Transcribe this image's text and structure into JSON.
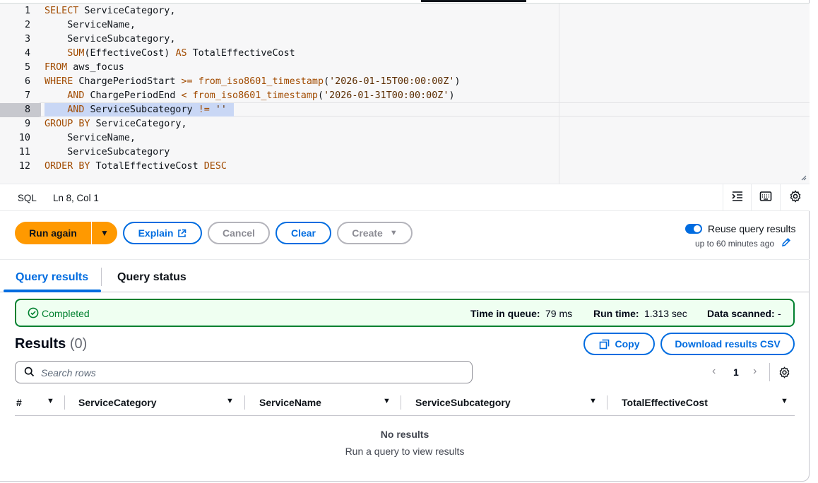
{
  "editor": {
    "lines": [
      {
        "n": "1",
        "tokens": [
          [
            "kw",
            "SELECT"
          ],
          [
            "",
            " ServiceCategory,"
          ]
        ]
      },
      {
        "n": "2",
        "tokens": [
          [
            "",
            "    ServiceName,"
          ]
        ]
      },
      {
        "n": "3",
        "tokens": [
          [
            "",
            "    ServiceSubcategory,"
          ]
        ]
      },
      {
        "n": "4",
        "tokens": [
          [
            "",
            "    "
          ],
          [
            "kw",
            "SUM"
          ],
          [
            "",
            "(EffectiveCost) "
          ],
          [
            "kw",
            "AS"
          ],
          [
            "",
            " TotalEffectiveCost"
          ]
        ]
      },
      {
        "n": "5",
        "tokens": [
          [
            "kw",
            "FROM"
          ],
          [
            "",
            " aws_focus"
          ]
        ]
      },
      {
        "n": "6",
        "tokens": [
          [
            "kw",
            "WHERE"
          ],
          [
            "",
            " ChargePeriodStart "
          ],
          [
            "kw",
            ">="
          ],
          [
            "",
            " "
          ],
          [
            "kw",
            "from_iso8601_timestamp"
          ],
          [
            "",
            "("
          ],
          [
            "str",
            "'2026-01-15T00:00:00Z'"
          ],
          [
            "",
            ")"
          ]
        ]
      },
      {
        "n": "7",
        "tokens": [
          [
            "",
            "    "
          ],
          [
            "kw",
            "AND"
          ],
          [
            "",
            " ChargePeriodEnd "
          ],
          [
            "kw",
            "<"
          ],
          [
            "",
            " "
          ],
          [
            "kw",
            "from_iso8601_timestamp"
          ],
          [
            "",
            "("
          ],
          [
            "str",
            "'2026-01-31T00:00:00Z'"
          ],
          [
            "",
            ")"
          ]
        ]
      },
      {
        "n": "8",
        "tokens": [
          [
            "",
            "    "
          ],
          [
            "kw",
            "AND"
          ],
          [
            "",
            " ServiceSubcategory "
          ],
          [
            "kw",
            "!="
          ],
          [
            "",
            " "
          ],
          [
            "str",
            "''"
          ]
        ]
      },
      {
        "n": "9",
        "tokens": [
          [
            "kw",
            "GROUP BY"
          ],
          [
            "",
            " ServiceCategory,"
          ]
        ]
      },
      {
        "n": "10",
        "tokens": [
          [
            "",
            "    ServiceName,"
          ]
        ]
      },
      {
        "n": "11",
        "tokens": [
          [
            "",
            "    ServiceSubcategory"
          ]
        ]
      },
      {
        "n": "12",
        "tokens": [
          [
            "kw",
            "ORDER BY"
          ],
          [
            "",
            " TotalEffectiveCost "
          ],
          [
            "kw",
            "DESC"
          ]
        ]
      }
    ],
    "active_line": 8
  },
  "statusbar": {
    "language": "SQL",
    "cursor": "Ln 8, Col 1"
  },
  "actions": {
    "run_again": "Run again",
    "explain": "Explain",
    "cancel": "Cancel",
    "clear": "Clear",
    "create": "Create",
    "reuse_label": "Reuse query results",
    "reuse_sub": "up to 60 minutes ago"
  },
  "tabs": {
    "query_results": "Query results",
    "query_status": "Query status"
  },
  "banner": {
    "status": "Completed",
    "queue_label": "Time in queue:",
    "queue_value": "79 ms",
    "run_label": "Run time:",
    "run_value": "1.313 sec",
    "scanned_label": "Data scanned:",
    "scanned_value": "-"
  },
  "results": {
    "title": "Results",
    "count": "(0)",
    "copy": "Copy",
    "download": "Download results CSV",
    "search_placeholder": "Search rows",
    "page": "1",
    "columns": [
      "#",
      "ServiceCategory",
      "ServiceName",
      "ServiceSubcategory",
      "TotalEffectiveCost"
    ],
    "empty_title": "No results",
    "empty_sub": "Run a query to view results"
  },
  "colors": {
    "primary": "#ff9900",
    "link": "#006ce0",
    "success": "#00802f"
  }
}
